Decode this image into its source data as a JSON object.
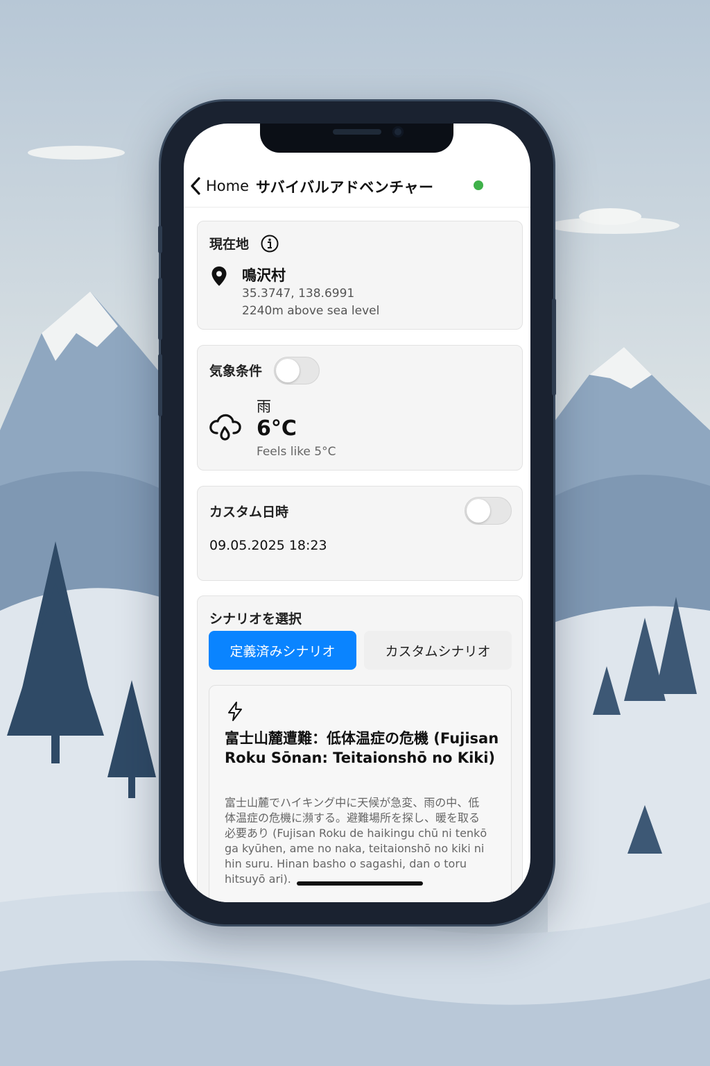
{
  "nav": {
    "back_label": "Home",
    "title": "サバイバルアドベンチャー",
    "status_color": "#3fb14a"
  },
  "location": {
    "title": "現在地",
    "name": "鳴沢村",
    "coords": "35.3747, 138.6991",
    "altitude": "2240m above sea level",
    "icon": "map-pin-icon"
  },
  "weather": {
    "title": "気象条件",
    "toggle_on": false,
    "condition": "雨",
    "temperature": "6°C",
    "feels_like": "Feels like 5°C",
    "icon": "cloud-rain-icon"
  },
  "custom_datetime": {
    "title": "カスタム日時",
    "toggle_on": false,
    "value": "09.05.2025 18:23"
  },
  "scenario": {
    "title": "シナリオを選択",
    "tabs": [
      {
        "label": "定義済みシナリオ",
        "active": true
      },
      {
        "label": "カスタムシナリオ",
        "active": false
      }
    ],
    "card": {
      "icon": "lightning-icon",
      "title": "富士山麓遭難：低体温症の危機 (Fujisan Roku Sōnan: Teitaionshō no Kiki)",
      "description": "富士山麓でハイキング中に天候が急変、雨の中、低体温症の危機に瀕する。避難場所を探し、暖を取る必要あり (Fujisan Roku de haikingu chū ni tenkō ga kyūhen, ame no naka, teitaionshō no kiki ni hin suru. Hinan basho o sagashi, dan o toru hitsuyō ari)."
    }
  },
  "colors": {
    "accent": "#0a84ff",
    "card_bg": "#f5f5f5"
  }
}
